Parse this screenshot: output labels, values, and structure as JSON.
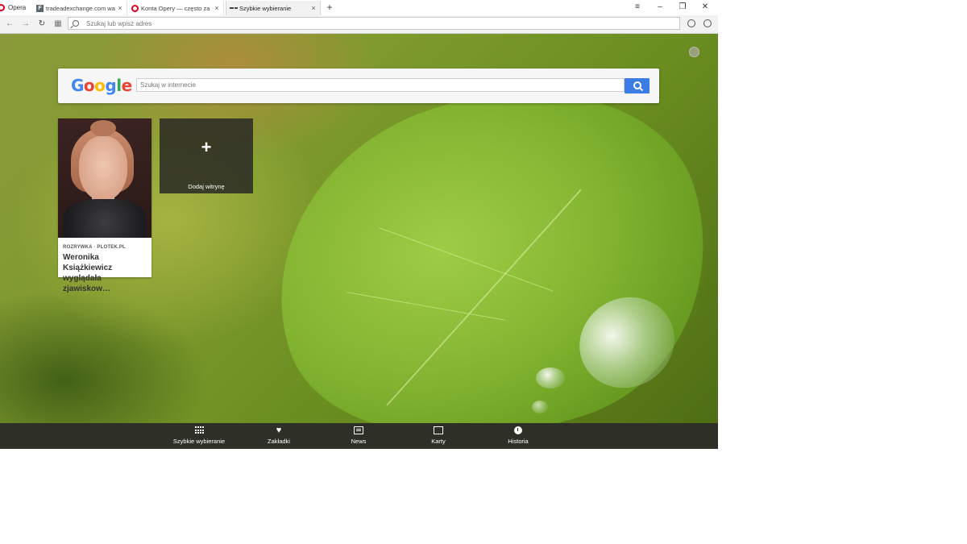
{
  "tabbar": {
    "opera_label": "Opera",
    "tabs": [
      {
        "title": "tradeadexchange.com wa",
        "close": "×",
        "active": false
      },
      {
        "title": "Konta Opery — często za",
        "close": "×",
        "active": false
      },
      {
        "title": "Szybkie wybieranie",
        "close": "×",
        "active": true
      }
    ],
    "new_tab": "+",
    "window_controls": {
      "menu": "≡",
      "minimize": "–",
      "restore": "❐",
      "close": "✕"
    }
  },
  "addressbar": {
    "back": "←",
    "forward": "→",
    "reload": "↻",
    "speed_dial": "▦",
    "placeholder": "Szukaj lub wpisz adres",
    "value": ""
  },
  "search": {
    "logo_letters": [
      {
        "char": "G",
        "color": "#4285f4"
      },
      {
        "char": "o",
        "color": "#ea4335"
      },
      {
        "char": "o",
        "color": "#fbbc05"
      },
      {
        "char": "g",
        "color": "#4285f4"
      },
      {
        "char": "l",
        "color": "#34a853"
      },
      {
        "char": "e",
        "color": "#ea4335"
      }
    ],
    "placeholder": "Szukaj w internecie",
    "button_color": "#3b7de4"
  },
  "tiles": {
    "news": {
      "source": "ROZRYWKA · PLOTEK.PL",
      "headline": "Weronika Książkiewicz wyglądała zjawiskow…"
    },
    "add": {
      "plus": "+",
      "label": "Dodaj witrynę"
    }
  },
  "bottom_nav": [
    {
      "label": "Szybkie wybieranie",
      "icon": "grid-icon"
    },
    {
      "label": "Zakładki",
      "icon": "heart-icon"
    },
    {
      "label": "News",
      "icon": "news-icon"
    },
    {
      "label": "Karty",
      "icon": "devices-icon"
    },
    {
      "label": "Historia",
      "icon": "clock-icon"
    }
  ],
  "colors": {
    "opera_red": "#e0001b",
    "accent_blue": "#3b7de4"
  }
}
